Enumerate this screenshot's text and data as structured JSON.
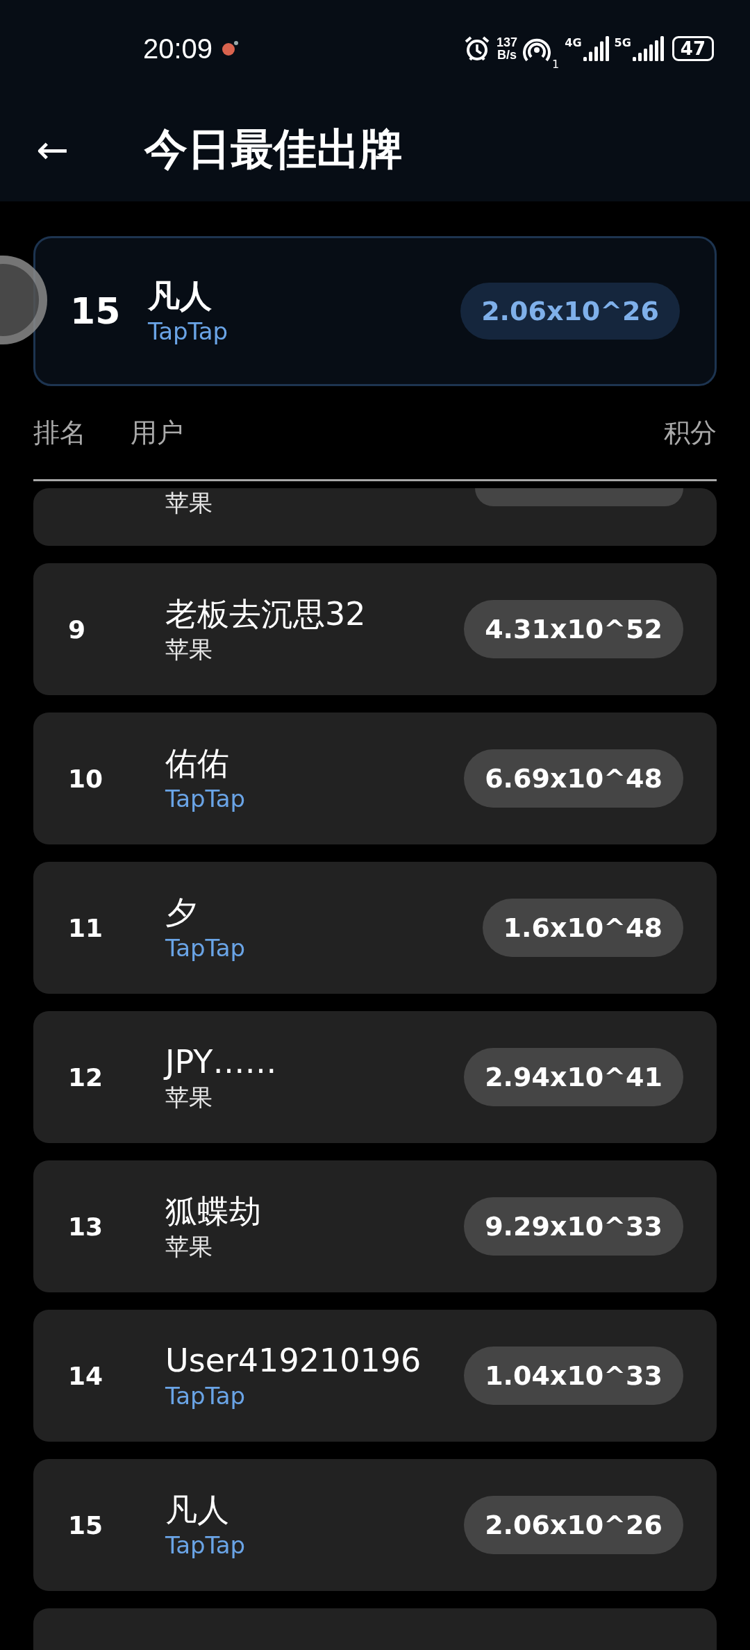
{
  "status_bar": {
    "time": "20:09",
    "speed_value": "137",
    "speed_unit": "B/s",
    "hotspot_count": "1",
    "network_1": "4G",
    "network_2": "5G",
    "battery": "47"
  },
  "header": {
    "back": "←",
    "title": "今日最佳出牌"
  },
  "my_rank": {
    "rank": "15",
    "name": "凡人",
    "platform": {
      "text": "TapTap",
      "color": "#6aa4e6"
    },
    "score": "2.06x10^26"
  },
  "columns": [
    "排名",
    "用户",
    "积分"
  ],
  "rows": [
    {
      "kind": "partial",
      "platform": {
        "text": "苹果",
        "color": "#e6e6e6"
      }
    },
    {
      "kind": "full",
      "rank": "9",
      "name": "老板去沉思32",
      "platform": {
        "text": "苹果",
        "color": "#e6e6e6"
      },
      "score": "4.31x10^52"
    },
    {
      "kind": "full",
      "rank": "10",
      "name": "佑佑",
      "platform": {
        "text": "TapTap",
        "color": "#6aa4e6"
      },
      "score": "6.69x10^48"
    },
    {
      "kind": "full",
      "rank": "11",
      "name": "夕",
      "platform": {
        "text": "TapTap",
        "color": "#6aa4e6"
      },
      "score": "1.6x10^48"
    },
    {
      "kind": "full",
      "rank": "12",
      "name": "JPY……",
      "platform": {
        "text": "苹果",
        "color": "#e6e6e6"
      },
      "score": "2.94x10^41"
    },
    {
      "kind": "full",
      "rank": "13",
      "name": "狐蝶劫",
      "platform": {
        "text": "苹果",
        "color": "#e6e6e6"
      },
      "score": "9.29x10^33"
    },
    {
      "kind": "full",
      "rank": "14",
      "name": "User419210196",
      "platform": {
        "text": "TapTap",
        "color": "#6aa4e6"
      },
      "score": "1.04x10^33"
    },
    {
      "kind": "full",
      "rank": "15",
      "name": "凡人",
      "platform": {
        "text": "TapTap",
        "color": "#6aa4e6"
      },
      "score": "2.06x10^26"
    },
    {
      "kind": "stub"
    }
  ]
}
